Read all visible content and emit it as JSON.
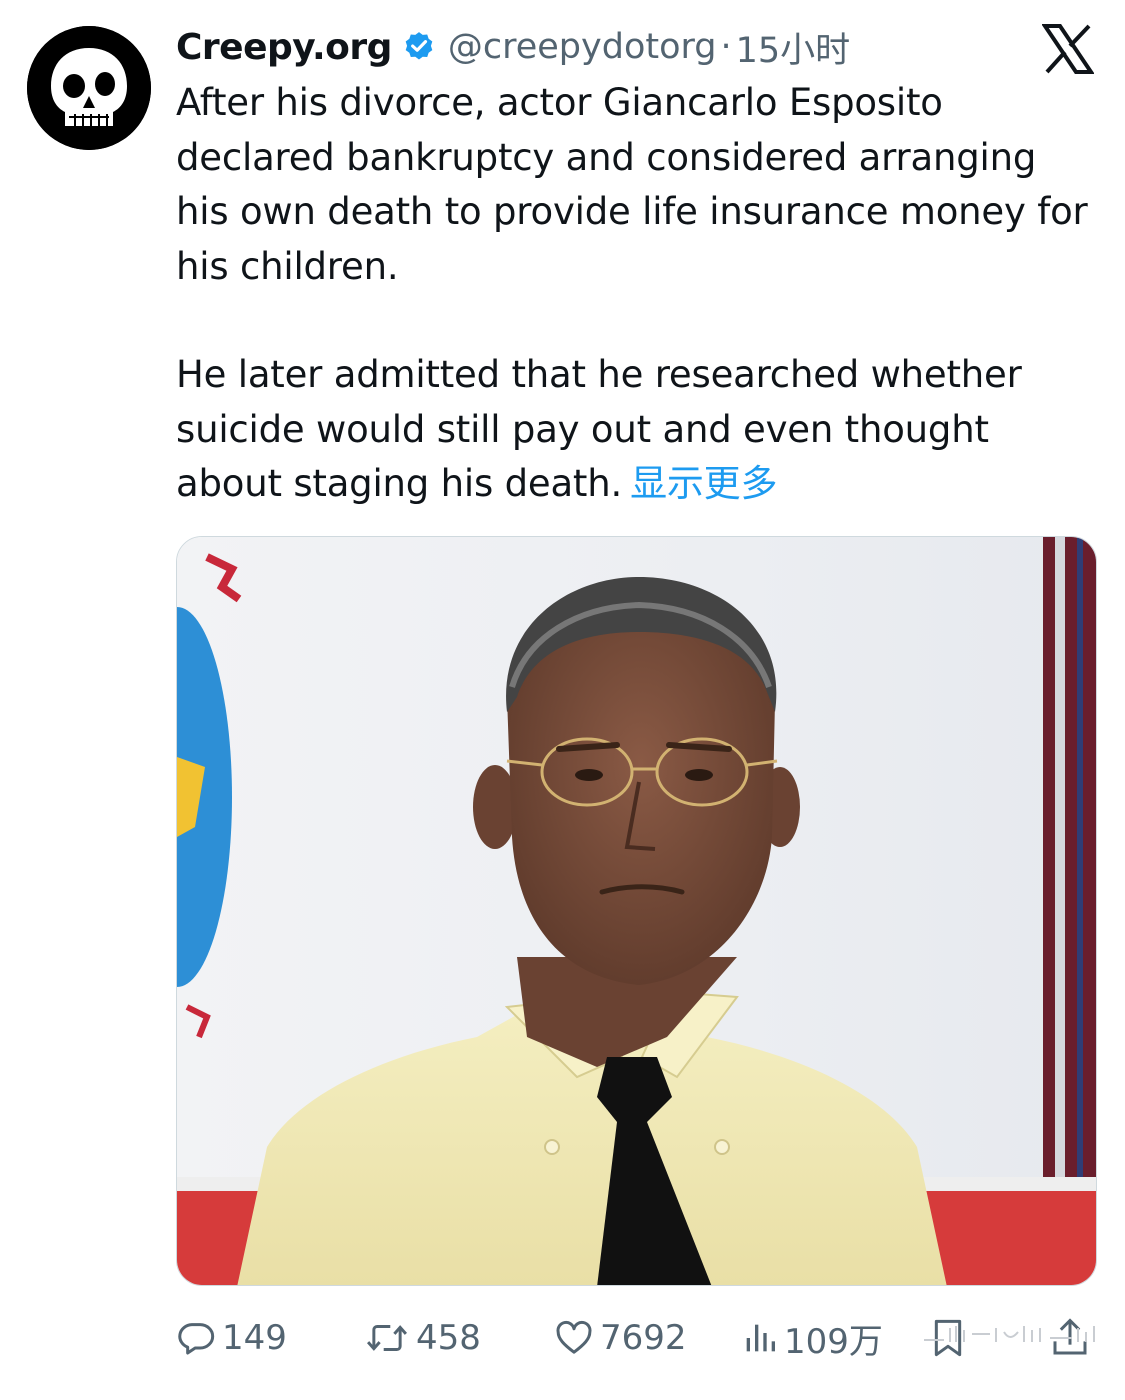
{
  "author": {
    "display_name": "Creepy.org",
    "handle": "@creepydotorg",
    "separator": "·",
    "timestamp": "15小时",
    "verified": true,
    "avatar_icon": "skull-icon"
  },
  "platform_logo": "x-logo-icon",
  "tweet": {
    "paragraphs": [
      "After his divorce, actor Giancarlo Esposito declared bankruptcy and considered arranging his own death to provide life insurance money for his children.",
      "He later admitted that he researched whether suicide would still pay out and even thought about staging his death."
    ],
    "show_more": "显示更多"
  },
  "media": {
    "type": "photo",
    "icon": "photo-man-in-yellow-shirt"
  },
  "actions": {
    "replies": "149",
    "reposts": "458",
    "likes": "7692",
    "views": "109万"
  },
  "colors": {
    "link": "#1d9bf0",
    "secondary_text": "#536471",
    "primary_text": "#0f1419",
    "verified": "#1d9bf0"
  }
}
